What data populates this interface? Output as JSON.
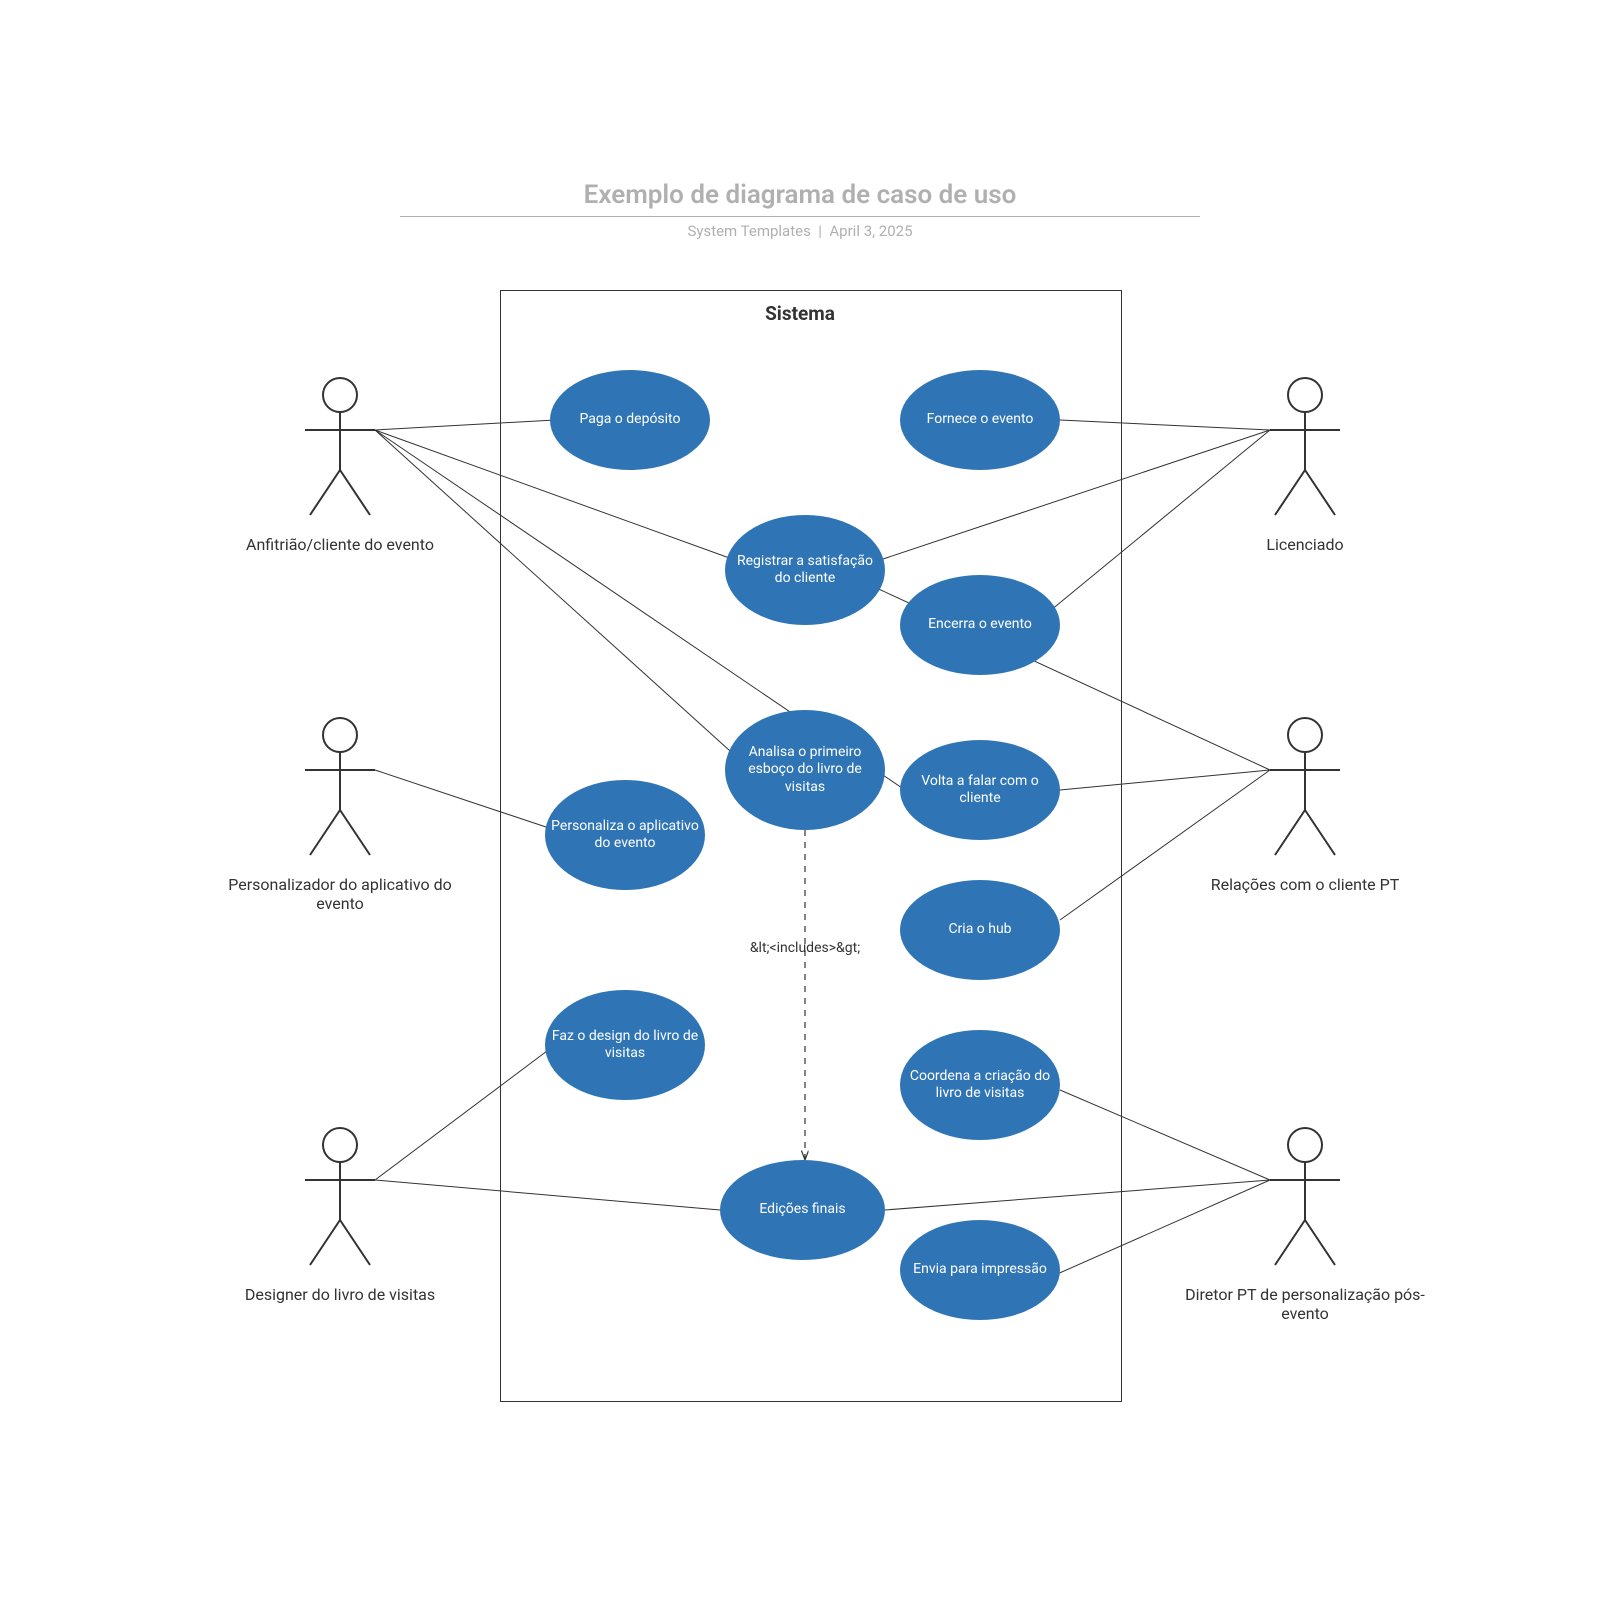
{
  "header": {
    "title": "Exemplo de diagrama de caso de uso",
    "subtitle_left": "System Templates",
    "subtitle_sep": "|",
    "subtitle_right": "April 3, 2025"
  },
  "system": {
    "label": "Sistema"
  },
  "usecases": {
    "paga": "Paga o depósito",
    "fornece": "Fornece o evento",
    "registrar": "Registrar a satisfação do cliente",
    "encerra": "Encerra o evento",
    "analisa": "Analisa o primeiro esboço do livro de visitas",
    "volta": "Volta a falar com o cliente",
    "personaliza": "Personaliza o aplicativo do evento",
    "criahub": "Cria o hub",
    "design": "Faz o design do livro de visitas",
    "coordena": "Coordena a criação do livro de visitas",
    "edicoes": "Edições finais",
    "envia": "Envia para impressão"
  },
  "actors": {
    "anfitriao": "Anfitrião/cliente do evento",
    "personalizador": "Personalizador do aplicativo do evento",
    "designer": "Designer do livro de visitas",
    "licenciado": "Licenciado",
    "relacoes": "Relações com o cliente PT",
    "diretor": "Diretor PT de personalização pós-evento"
  },
  "includes_label": "&lt;<includes>&gt;",
  "colors": {
    "usecase_fill": "#2f75b5",
    "text_muted": "#b0b0b0"
  }
}
